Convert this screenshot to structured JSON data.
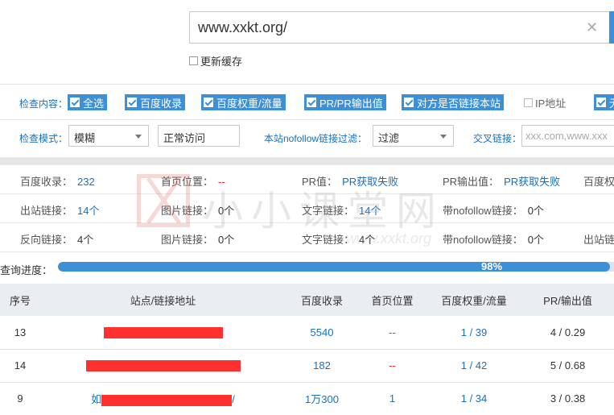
{
  "url_input": {
    "value": "www.xxkt.org/"
  },
  "cache_option": {
    "label": "更新缓存"
  },
  "check_content": {
    "label": "检查内容：",
    "options": [
      {
        "label": "全选",
        "checked": true
      },
      {
        "label": "百度收录",
        "checked": true
      },
      {
        "label": "百度权重/流量",
        "checked": true
      },
      {
        "label": "PR/PR输出值",
        "checked": true
      },
      {
        "label": "对方是否链接本站",
        "checked": true
      },
      {
        "label": "IP地址",
        "checked": false
      },
      {
        "label": "无",
        "checked": true
      }
    ]
  },
  "check_mode": {
    "label": "检查模式：",
    "mode_value": "模糊",
    "access_value": "正常访问",
    "nofollow_label": "本站nofollow链接过滤：",
    "nofollow_value": "过滤",
    "cross_label": "交叉链接：",
    "cross_placeholder": "xxx.com,www.xxx"
  },
  "stats": {
    "row1": [
      {
        "k": "百度收录：",
        "v": "232"
      },
      {
        "k": "首页位置：",
        "v": "--"
      },
      {
        "k": "PR值：",
        "v": "PR获取失败"
      },
      {
        "k": "PR输出值：",
        "v": "PR获取失败"
      },
      {
        "k": "百度权",
        "v": ""
      }
    ],
    "row2": [
      {
        "k": "出站链接：",
        "v": "14个"
      },
      {
        "k": "图片链接：",
        "v": "0个"
      },
      {
        "k": "文字链接：",
        "v": "14个"
      },
      {
        "k": "带nofollow链接：",
        "v": "0个"
      }
    ],
    "row3": [
      {
        "k": "反向链接：",
        "v": "4个"
      },
      {
        "k": "图片链接：",
        "v": "0个"
      },
      {
        "k": "文字链接：",
        "v": "4个"
      },
      {
        "k": "带nofollow链接：",
        "v": "0个"
      },
      {
        "k": "出站链",
        "v": ""
      }
    ]
  },
  "watermark": {
    "title": "小小课堂网",
    "url": "www.xxkt.org"
  },
  "progress": {
    "label": "查询进度：",
    "percent": 98,
    "text": "98%"
  },
  "table": {
    "headers": [
      "序号",
      "站点/链接地址",
      "百度收录",
      "首页位置",
      "百度权重/流量",
      "PR/输出值"
    ],
    "rows": [
      {
        "no": "13",
        "site_prefix": "",
        "site_suffix": "",
        "baidu": "5540",
        "pos": "--",
        "weight": "1 / 39",
        "pr": "4 / 0.29"
      },
      {
        "no": "14",
        "site_prefix": "",
        "site_suffix": "",
        "baidu": "182",
        "pos": "--",
        "weight": "1 / 42",
        "pr": "5 / 0.68"
      },
      {
        "no": "9",
        "site_prefix": "如",
        "site_suffix": "/",
        "baidu": "1万300",
        "pos": "1",
        "weight": "1 / 34",
        "pr": "3 / 0.38"
      }
    ]
  },
  "colors": {
    "accent": "#3d8fd6",
    "link": "#1a6fb8",
    "red": "#d33333",
    "redaction": "#ff3030"
  }
}
